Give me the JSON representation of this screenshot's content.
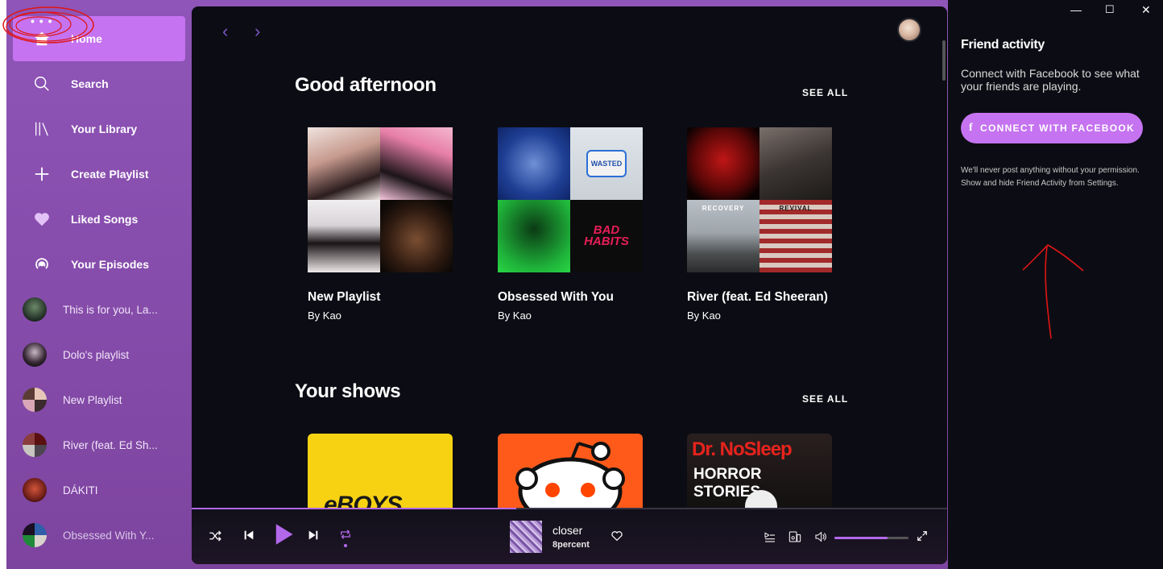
{
  "sidebar": {
    "menu_dots": "• • •",
    "nav": [
      {
        "label": "Home",
        "icon": "home-icon"
      },
      {
        "label": "Search",
        "icon": "search-icon"
      },
      {
        "label": "Your Library",
        "icon": "library-icon"
      },
      {
        "label": "Create Playlist",
        "icon": "plus-icon"
      },
      {
        "label": "Liked Songs",
        "icon": "heart-icon"
      },
      {
        "label": "Your Episodes",
        "icon": "podcast-icon"
      }
    ],
    "playlists": [
      {
        "label": "This is for you, La..."
      },
      {
        "label": "Dolo's playlist"
      },
      {
        "label": "New Playlist"
      },
      {
        "label": "River (feat. Ed Sh..."
      },
      {
        "label": "DÁKITI"
      },
      {
        "label": "Obsessed With Y..."
      }
    ]
  },
  "main": {
    "nav_back": "‹",
    "nav_forward": "›",
    "sections": [
      {
        "title": "Good afternoon",
        "see_all": "SEE ALL",
        "cards": [
          {
            "title": "New Playlist",
            "subtitle": "By Kao"
          },
          {
            "title": "Obsessed With You",
            "subtitle": "By Kao"
          },
          {
            "title": "River (feat. Ed Sheeran)",
            "subtitle": "By Kao"
          }
        ]
      },
      {
        "title": "Your shows",
        "see_all": "SEE ALL",
        "shows": [
          {
            "art_text": "eBOYS"
          },
          {
            "art_text": ""
          },
          {
            "art_text_1": "Dr. NoSleep",
            "art_text_2": "HORROR STORIES"
          }
        ]
      }
    ]
  },
  "album_art_text": {
    "wasted": "WASTED",
    "bad_habits": "BAD HABITS",
    "recovery": "RECOVERY",
    "revival": "REVIVAL"
  },
  "player": {
    "track": "closer",
    "artist": "8percent",
    "progress_fraction": 0.43,
    "volume_fraction": 0.72
  },
  "friend_activity": {
    "title": "Friend activity",
    "text": "Connect with Facebook to see what your friends are playing.",
    "button_icon": "f",
    "button_label": "CONNECT WITH FACEBOOK",
    "note": "We'll never post anything without your permission. Show and hide Friend Activity from Settings."
  },
  "window": {
    "minimize": "—",
    "maximize": "☐",
    "close": "✕"
  },
  "colors": {
    "accent": "#c573f0",
    "sidebar_bg": "#8a4fb0",
    "main_bg": "#0c0d14",
    "annotation": "#e01515"
  }
}
